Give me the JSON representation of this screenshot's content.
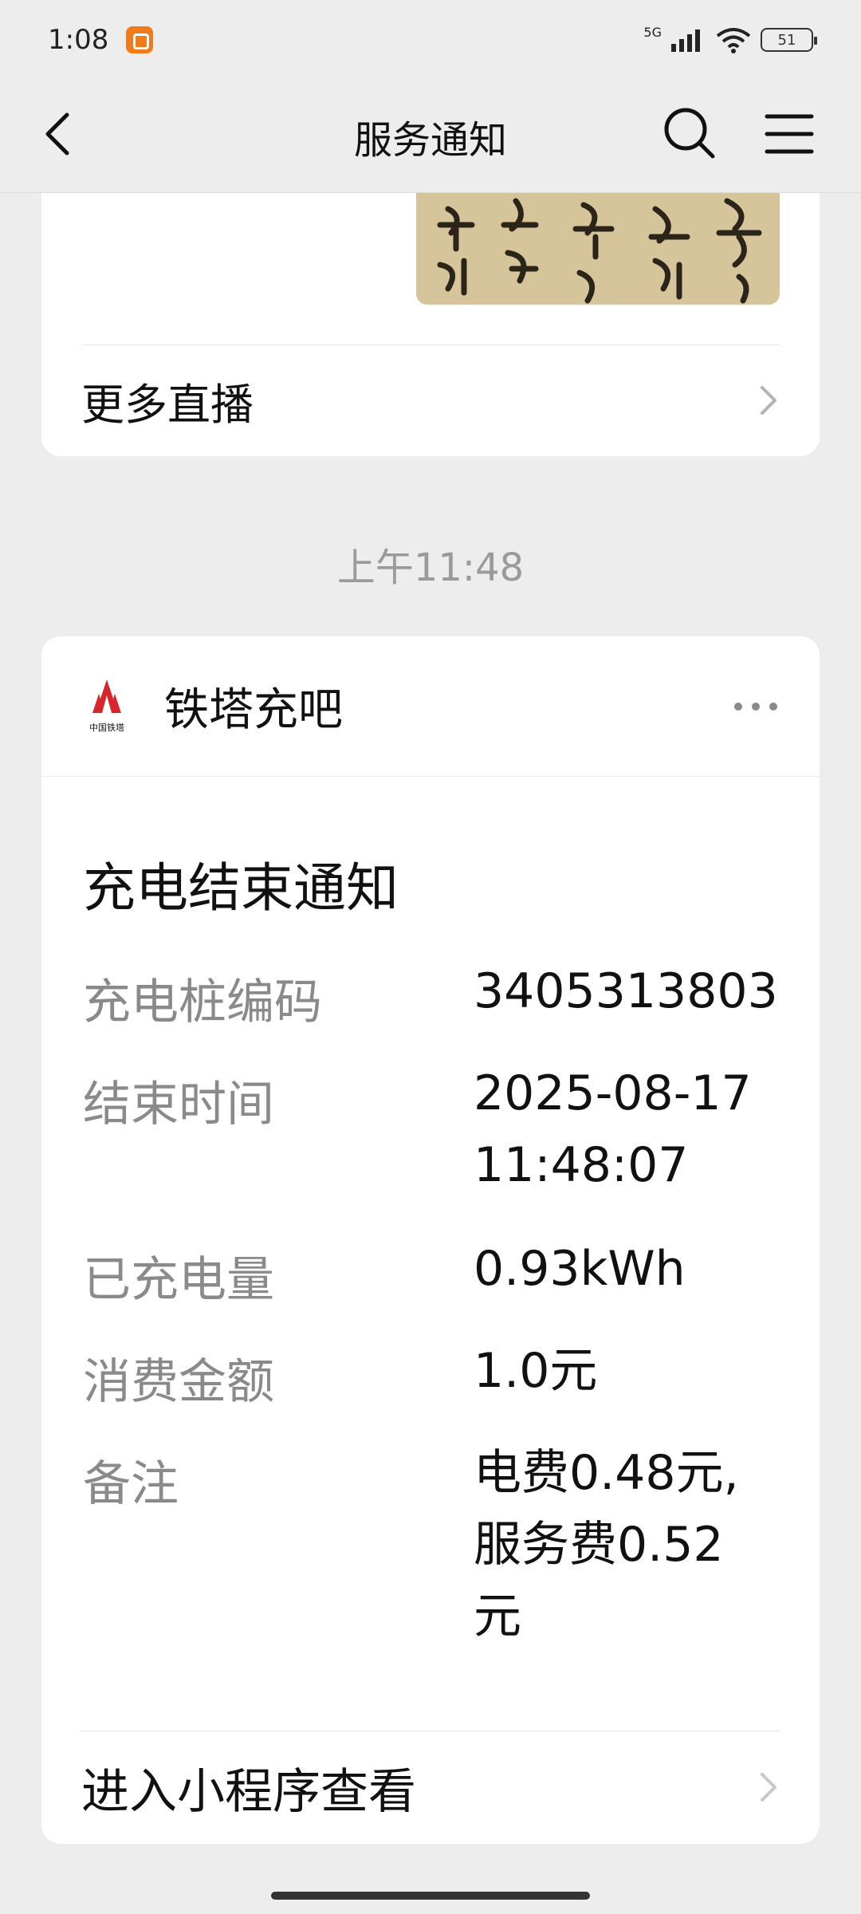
{
  "status_bar": {
    "time": "1:08",
    "network": "5G",
    "battery": "51"
  },
  "nav": {
    "title": "服务通知"
  },
  "prev_card": {
    "more_live_label": "更多直播"
  },
  "timestamp": "上午11:48",
  "notification": {
    "logo_text": "中国铁塔",
    "sender": "铁塔充吧",
    "title": "充电结束通知",
    "fields": [
      {
        "label": "充电桩编码",
        "value": "3405313803"
      },
      {
        "label": "结束时间",
        "value_line1": "2025-08-17",
        "value_line2": "11:48:07"
      },
      {
        "label": "已充电量",
        "value": "0.93kWh"
      },
      {
        "label": "消费金额",
        "value": "1.0元"
      },
      {
        "label": "备注",
        "value_line1": "电费0.48元,",
        "value_line2": "服务费0.52",
        "value_line3": "元"
      }
    ],
    "open_label": "进入小程序查看"
  },
  "colors": {
    "background": "#ededed",
    "card": "#ffffff",
    "label_gray": "#8a8a8a",
    "logo_red": "#d7262c"
  }
}
